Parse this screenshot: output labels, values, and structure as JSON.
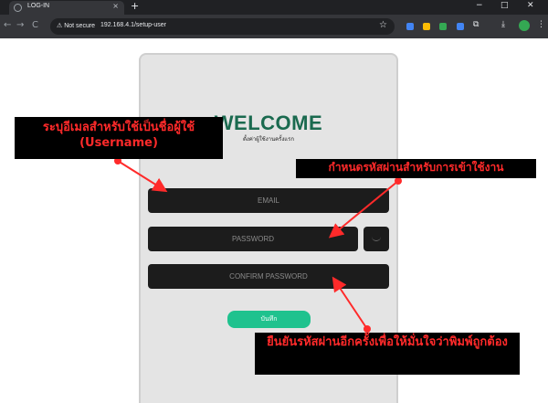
{
  "browser": {
    "tab_title": "LOG-IN",
    "tab_close": "×",
    "new_tab": "+",
    "window_controls": [
      "−",
      "□",
      "✕"
    ],
    "nav": [
      "←",
      "→",
      "C"
    ],
    "security_label": "⚠ Not secure",
    "url": "192.168.4.1/setup-user",
    "star": "☆",
    "download_icon": "⤓",
    "puzzle_icon": "⧉",
    "menu_icon": "⋮",
    "extension_colors": [
      "#4285f4",
      "#fbbc05",
      "#34a853",
      "#4285f4",
      "#34a853"
    ]
  },
  "form": {
    "title": "WELCOME",
    "subtitle": "ตั้งค่าผู้ใช้งานครั้งแรก",
    "email_placeholder": "EMAIL",
    "password_placeholder": "PASSWORD",
    "confirm_placeholder": "CONFIRM PASSWORD",
    "save_label": "บันทึก",
    "accent_color": "#1fc28e",
    "title_color": "#1a6a4f"
  },
  "annotations": {
    "email_note": "ระบุอีเมลสำหรับใช้เป็นชื่อผู้ใช้ (Username)",
    "password_note": "กำหนดรหัสผ่านสำหรับการเข้าใช้งาน",
    "confirm_note": "ยืนยันรหัสผ่านอีกครั้งเพื่อให้มั่นใจว่าพิมพ์ถูกต้อง",
    "arrow_color": "#ff2a2a"
  }
}
